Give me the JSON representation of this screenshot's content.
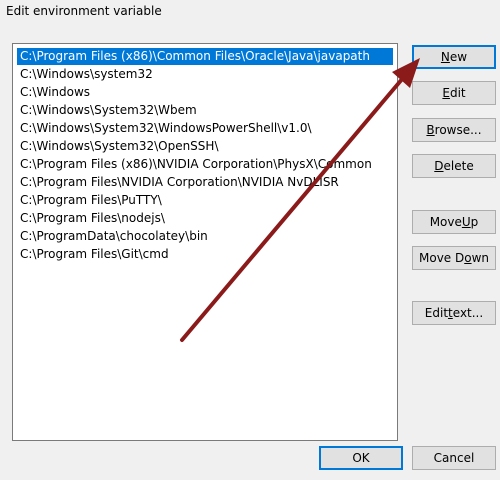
{
  "window": {
    "title": "Edit environment variable"
  },
  "paths": [
    "C:\\Program Files (x86)\\Common Files\\Oracle\\Java\\javapath",
    "C:\\Windows\\system32",
    "C:\\Windows",
    "C:\\Windows\\System32\\Wbem",
    "C:\\Windows\\System32\\WindowsPowerShell\\v1.0\\",
    "C:\\Windows\\System32\\OpenSSH\\",
    "C:\\Program Files (x86)\\NVIDIA Corporation\\PhysX\\Common",
    "C:\\Program Files\\NVIDIA Corporation\\NVIDIA NvDLISR",
    "C:\\Program Files\\PuTTY\\",
    "C:\\Program Files\\nodejs\\",
    "C:\\ProgramData\\chocolatey\\bin",
    "C:\\Program Files\\Git\\cmd"
  ],
  "selected_index": 0,
  "buttons": {
    "new": {
      "pre": "",
      "u": "N",
      "post": "ew"
    },
    "edit": {
      "pre": "",
      "u": "E",
      "post": "dit"
    },
    "browse": {
      "pre": "",
      "u": "B",
      "post": "rowse..."
    },
    "delete": {
      "pre": "",
      "u": "D",
      "post": "elete"
    },
    "move_up": {
      "pre": "Move ",
      "u": "U",
      "post": "p"
    },
    "move_down": {
      "pre": "Move D",
      "u": "o",
      "post": "wn"
    },
    "edit_text": {
      "pre": "Edit ",
      "u": "t",
      "post": "ext..."
    }
  },
  "footer": {
    "ok_label": "OK",
    "cancel_label": "Cancel"
  },
  "annotation": {
    "arrow_color": "#8b1a1a",
    "icon": "arrow-icon"
  },
  "colors": {
    "selection": "#0078d7",
    "dialog_bg": "#f0f0f0"
  }
}
